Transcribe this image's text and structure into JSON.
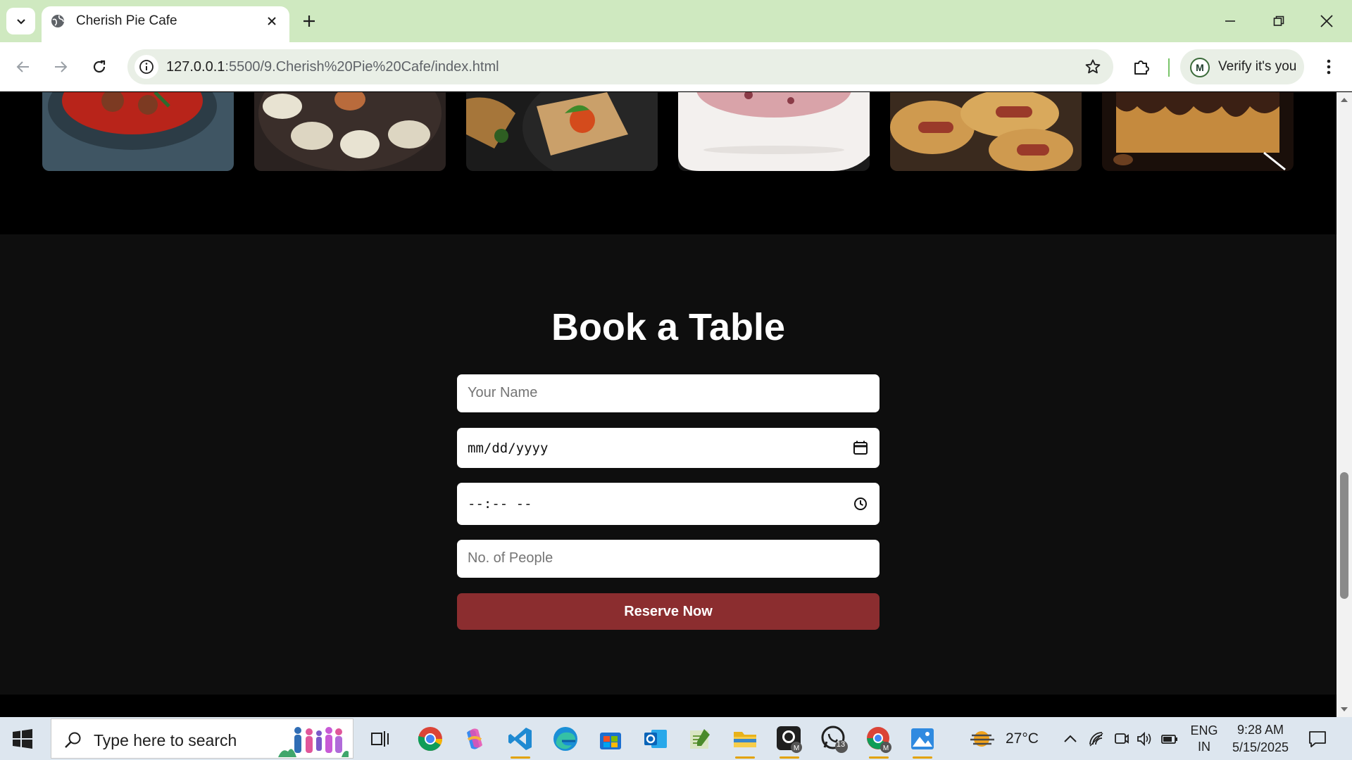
{
  "browser": {
    "tab": {
      "title": "Cherish Pie Cafe"
    },
    "url": {
      "host": "127.0.0.1",
      "path": ":5500/9.Cherish%20Pie%20Cafe/index.html"
    },
    "profile": {
      "initial": "M",
      "label": "Verify it's you"
    }
  },
  "gallery": {
    "items": [
      {
        "name": "spaghetti-meatballs",
        "colors": [
          "#3f5563",
          "#b8241a",
          "#7c3a22"
        ]
      },
      {
        "name": "dumplings",
        "colors": [
          "#3a2e2a",
          "#e8e3d2",
          "#b96b3c"
        ]
      },
      {
        "name": "bruschetta",
        "colors": [
          "#1b1b1b",
          "#caa06a",
          "#d44b1c"
        ]
      },
      {
        "name": "ice-cream",
        "colors": [
          "#f3f0ee",
          "#d9a3a9",
          "#8a3b47"
        ]
      },
      {
        "name": "pigs-in-blanket",
        "colors": [
          "#cf9a4f",
          "#9a3a2a",
          "#3a2a1e"
        ]
      },
      {
        "name": "chocolate-cake",
        "colors": [
          "#c58a3e",
          "#3b2014",
          "#1a0f0a"
        ]
      }
    ]
  },
  "booking": {
    "title": "Book a Table",
    "name_placeholder": "Your Name",
    "date_placeholder": "mm/dd/yyyy",
    "time_placeholder": "--:-- --",
    "people_placeholder": "No. of People",
    "submit_label": "Reserve Now",
    "accent_color": "#8b2d2f"
  },
  "taskbar": {
    "search_placeholder": "Type here to search",
    "weather": {
      "temp": "27°C"
    },
    "language": {
      "line1": "ENG",
      "line2": "IN"
    },
    "clock": {
      "time": "9:28 AM",
      "date": "5/15/2025"
    },
    "whatsapp_badge": "13"
  }
}
